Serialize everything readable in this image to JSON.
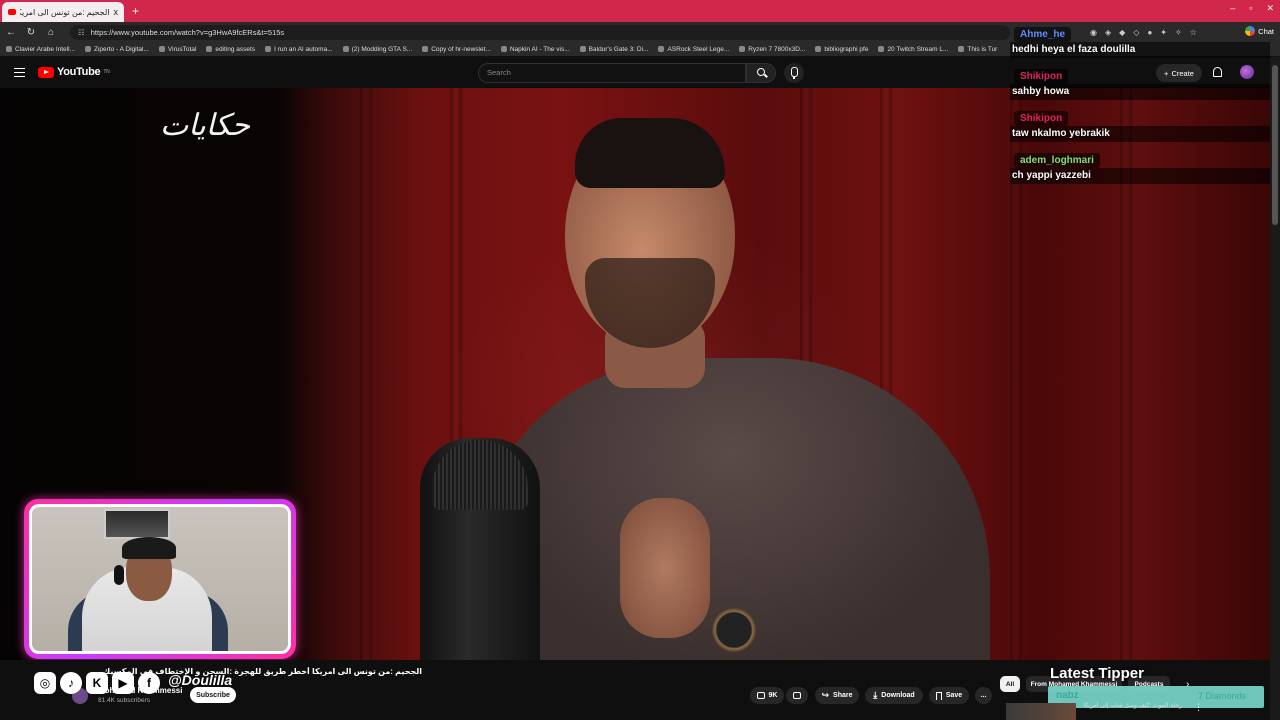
{
  "browser": {
    "tab_title": "الجحيم :من تونس الى امريكا أخطر طريق",
    "tab_close": "x",
    "new_tab": "+",
    "url": "https://www.youtube.com/watch?v=g3HwA9fcERs&t=515s",
    "chat_label": "Chat",
    "bookmarks": [
      "Clavier Arabe Intell...",
      "Ziperto - A Digital...",
      "VirusTotal",
      "editing assets",
      "I run an AI automa...",
      "(2) Modding GTA S...",
      "Copy of hr-newslet...",
      "Napkin AI - The vis...",
      "Baldur's Gate 3: Di...",
      "ASRock Steel Lege...",
      "Ryzen 7 7800x3D...",
      "bibliographi pfe",
      "20 Twitch Stream L...",
      "This is Tur"
    ]
  },
  "youtube": {
    "logo_text": "YouTube",
    "logo_sup": "TN",
    "search_placeholder": "Search",
    "create_label": "Create"
  },
  "video": {
    "overlay_logo": "حكايات"
  },
  "chat": [
    {
      "name": "Ahme_he",
      "text": "hedhi heya el faza doulilla",
      "color": "#5b8cff"
    },
    {
      "name": "Shikipon",
      "text": "sahby howa",
      "color": "#e0245e"
    },
    {
      "name": "Shikipon",
      "text": "taw nkalmo yebrakik",
      "color": "#e0245e"
    },
    {
      "name": "adem_loghmari",
      "text": "ch yappi yazzebi",
      "color": "#7be07b"
    }
  ],
  "stream_overlay": {
    "handle": "@Doulilla",
    "latest_tipper_label": "Latest Tipper",
    "tipper_name": "nabz",
    "tipper_amount": "7 Diamonds"
  },
  "video_info": {
    "title": "الجحيم :من تونس الى امريكا أخطر طريق للهجرة :السجن و الإختطاف في المكسيك",
    "channel_name": "Mohamed Khammessi",
    "subscribers": "81.4K subscribers",
    "subscribe_label": "Subscribe",
    "likes": "9K",
    "share_label": "Share",
    "download_label": "Download",
    "save_label": "Save",
    "more_label": "..."
  },
  "recommendations": {
    "chips": [
      "All",
      "From Mohamed Khammessi",
      "Podcasts"
    ],
    "first_title": "رحلة الموت :كيف وصل شاب إلى أمريكا"
  },
  "colors": {
    "tabbar": "#d1274b",
    "webcam_border": "#ff2fa0",
    "tipper_accent": "#7fe6d8"
  }
}
